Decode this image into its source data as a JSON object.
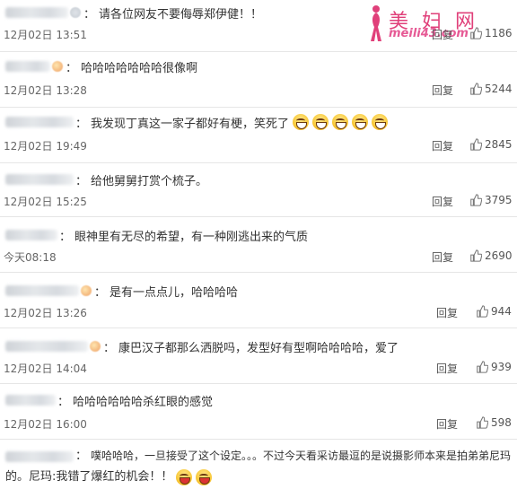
{
  "watermark": {
    "title": "美 妇 网",
    "url": "meili43.com"
  },
  "actions": {
    "reply_label": "回复"
  },
  "comments": [
    {
      "text": "请各位网友不要侮辱郑伊健！！",
      "date": "12月02日 13:51",
      "likes": "1186",
      "emojis": 0
    },
    {
      "text": "哈哈哈哈哈哈哈很像啊",
      "date": "12月02日 13:28",
      "likes": "5244",
      "emojis": 0
    },
    {
      "text": "我发现丁真这一家子都好有梗，笑死了",
      "date": "12月02日 19:49",
      "likes": "2845",
      "emojis": 5
    },
    {
      "text": "给他舅舅打赏个梳子。",
      "date": "12月02日 15:25",
      "likes": "3795",
      "emojis": 0
    },
    {
      "text": "眼神里有无尽的希望，有一种刚逃出来的气质",
      "date": "今天08:18",
      "likes": "2690",
      "emojis": 0
    },
    {
      "text": "是有一点点儿，哈哈哈哈",
      "date": "12月02日 13:26",
      "likes": "944",
      "emojis": 0
    },
    {
      "text": "康巴汉子都那么洒脱吗，发型好有型啊哈哈哈哈，爱了",
      "date": "12月02日 14:04",
      "likes": "939",
      "emojis": 0
    },
    {
      "text": "哈哈哈哈哈哈杀红眼的感觉",
      "date": "12月02日 16:00",
      "likes": "598",
      "emojis": 0
    },
    {
      "text_line1": "噗哈哈哈，一旦接受了这个设定。。。不过今天看采访最逗的是说摄影师本来是拍弟弟尼玛",
      "text_line2": "的。尼玛:我错了爆红的机会！！",
      "emojis": 2
    }
  ],
  "colors": {
    "watermark_pink": "#e0407a",
    "separator": "#e6e6e6",
    "text": "#333333",
    "meta": "#666666"
  }
}
